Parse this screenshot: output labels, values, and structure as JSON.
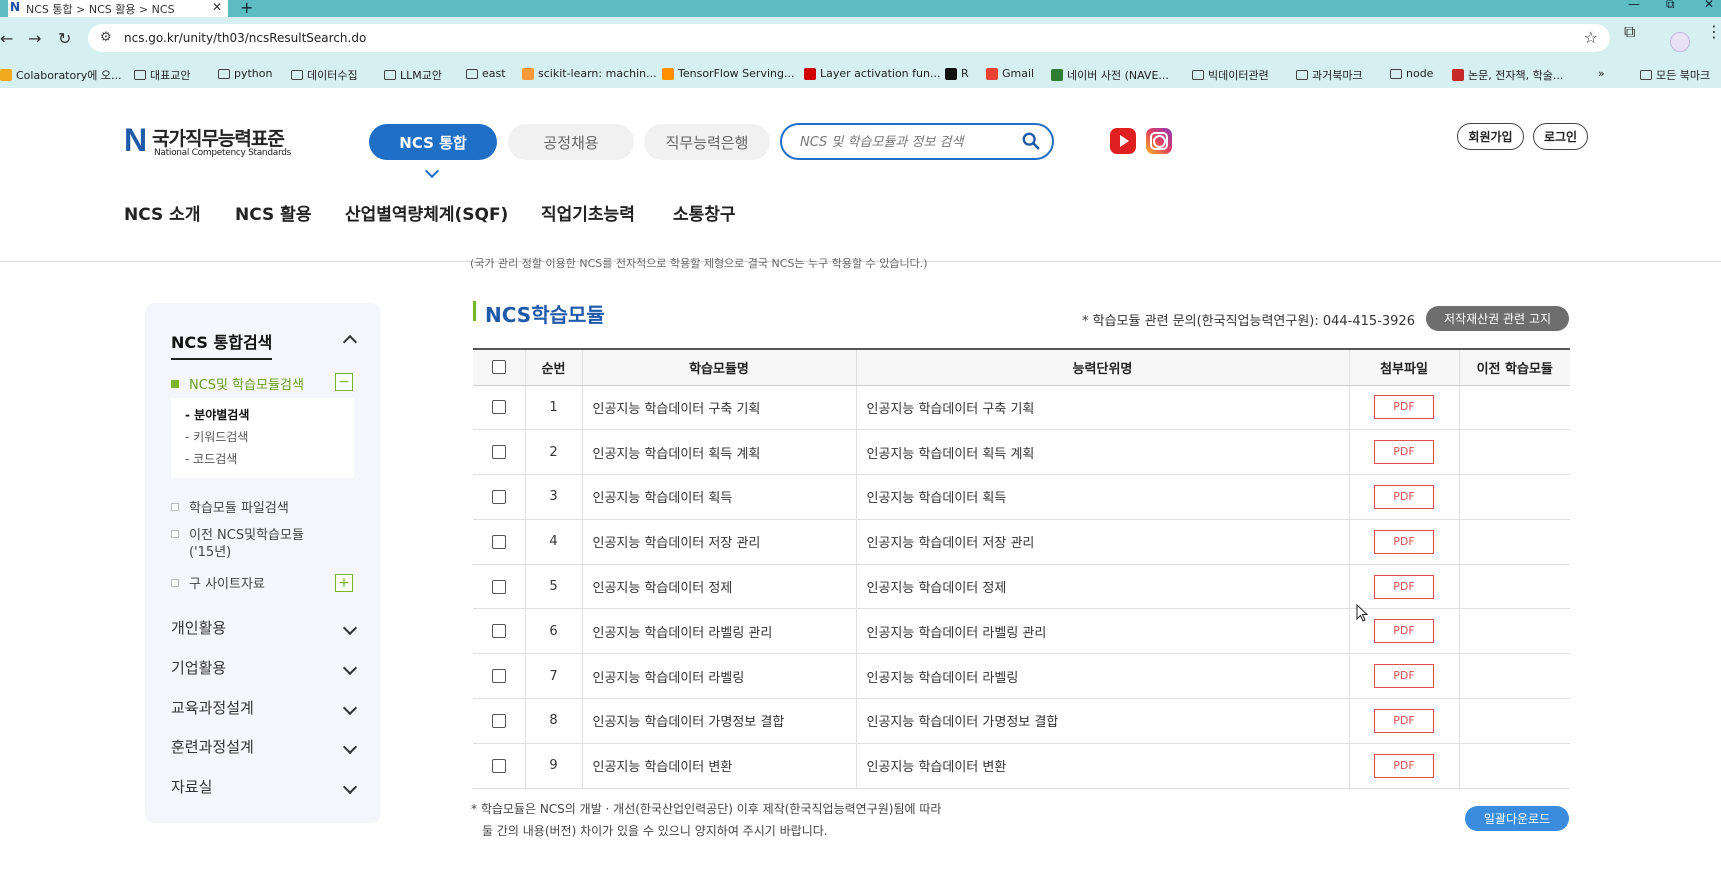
{
  "browser": {
    "tab_title": "NCS 통합 > NCS 활용 > NCS",
    "new_tab": "+",
    "url": "ncs.go.kr/unity/th03/ncsResultSearch.do",
    "window_controls": [
      "—",
      "⧉",
      "✕"
    ],
    "bookmarks": [
      {
        "label": "Colaboratory에 오...",
        "icon": "colab-icon"
      },
      {
        "label": "대표교안",
        "icon": "folder-icon"
      },
      {
        "label": "python",
        "icon": "folder-icon"
      },
      {
        "label": "데이터수집",
        "icon": "folder-icon"
      },
      {
        "label": "LLM교안",
        "icon": "folder-icon"
      },
      {
        "label": "east",
        "icon": "folder-icon"
      },
      {
        "label": "scikit-learn: machin...",
        "icon": "sklearn-icon"
      },
      {
        "label": "TensorFlow Serving...",
        "icon": "tensorflow-icon"
      },
      {
        "label": "Layer activation fun...",
        "icon": "keras-icon"
      },
      {
        "label": "R",
        "icon": "r-icon"
      },
      {
        "label": "Gmail",
        "icon": "gmail-icon"
      },
      {
        "label": "네이버 사전 (NAVE...",
        "icon": "naver-icon"
      },
      {
        "label": "빅데이터관련",
        "icon": "folder-icon"
      },
      {
        "label": "과거북마크",
        "icon": "folder-icon"
      },
      {
        "label": "node",
        "icon": "folder-icon"
      },
      {
        "label": "논문, 전자책, 학술...",
        "icon": "dbpia-icon"
      }
    ],
    "bookmarks_more": "»",
    "all_bookmarks": "모든 북마크"
  },
  "header": {
    "logo_mark": "N",
    "logo_ko": "국가직무능력표준",
    "logo_en": "National Competency Standards",
    "top_tabs": [
      "NCS 통합",
      "공정채용",
      "직무능력은행"
    ],
    "search_placeholder": "NCS 및 학습모듈과 정보 검색",
    "join": "회원가입",
    "login": "로그인",
    "gnb": [
      "NCS 소개",
      "NCS 활용",
      "산업별역량체계(SQF)",
      "직업기초능력",
      "소통창구"
    ],
    "clipped_text": "(국가 관리 정할 이용한 NCS를 전자적으로 학용할 제형으로 결국 NCS는 누구 학용할 수 있습니다.)"
  },
  "sidebar": {
    "title": "NCS 통합검색",
    "search_ncs": "NCS및 학습모듈검색",
    "sub_items": [
      "분야별검색",
      "키워드검색",
      "코드검색"
    ],
    "file_search": "학습모듈 파일검색",
    "old_ncs_line1": "이전 NCS및학습모듈",
    "old_ncs_line2": "('15년)",
    "old_site": "구 사이트자료",
    "menus": [
      "개인활용",
      "기업활용",
      "교육과정설계",
      "훈련과정설계",
      "자료실"
    ]
  },
  "main": {
    "title": "NCS학습모듈",
    "inquiry": "* 학습모듈 관련 문의(한국직업능력연구원): 044-415-3926",
    "copyright_button": "저작재산권 관련 고지",
    "columns": [
      "순번",
      "학습모듈명",
      "능력단위명",
      "첨부파일",
      "이전 학습모듈"
    ],
    "pdf_label": "PDF",
    "rows": [
      {
        "no": "1",
        "module": "인공지능 학습데이터 구축 기획",
        "unit": "인공지능 학습데이터 구축 기획"
      },
      {
        "no": "2",
        "module": "인공지능 학습데이터 획득 계획",
        "unit": "인공지능 학습데이터 획득 계획"
      },
      {
        "no": "3",
        "module": "인공지능 학습데이터 획득",
        "unit": "인공지능 학습데이터 획득"
      },
      {
        "no": "4",
        "module": "인공지능 학습데이터 저장 관리",
        "unit": "인공지능 학습데이터 저장 관리"
      },
      {
        "no": "5",
        "module": "인공지능 학습데이터 정제",
        "unit": "인공지능 학습데이터 정제"
      },
      {
        "no": "6",
        "module": "인공지능 학습데이터 라벨링 관리",
        "unit": "인공지능 학습데이터 라벨링 관리"
      },
      {
        "no": "7",
        "module": "인공지능 학습데이터 라벨링",
        "unit": "인공지능 학습데이터 라벨링"
      },
      {
        "no": "8",
        "module": "인공지능 학습데이터 가명정보 결합",
        "unit": "인공지능 학습데이터 가명정보 결합"
      },
      {
        "no": "9",
        "module": "인공지능 학습데이터 변환",
        "unit": "인공지능 학습데이터 변환"
      }
    ],
    "notice_line1": "* 학습모듈은 NCS의 개발 · 개선(한국산업인력공단) 이후 제작(한국직업능력연구원)됨에 따라",
    "notice_line2": "둘 간의 내용(버전) 차이가 있을 수 있으니 양지하여 주시기 바랍니다.",
    "download_all": "일괄다운로드"
  },
  "colors": {
    "tabstrip": "#5dbcc2",
    "toolbar": "#d6eff1",
    "brand_blue": "#1f6fc7",
    "accent_green": "#79b526",
    "pdf_red": "#e05050"
  }
}
